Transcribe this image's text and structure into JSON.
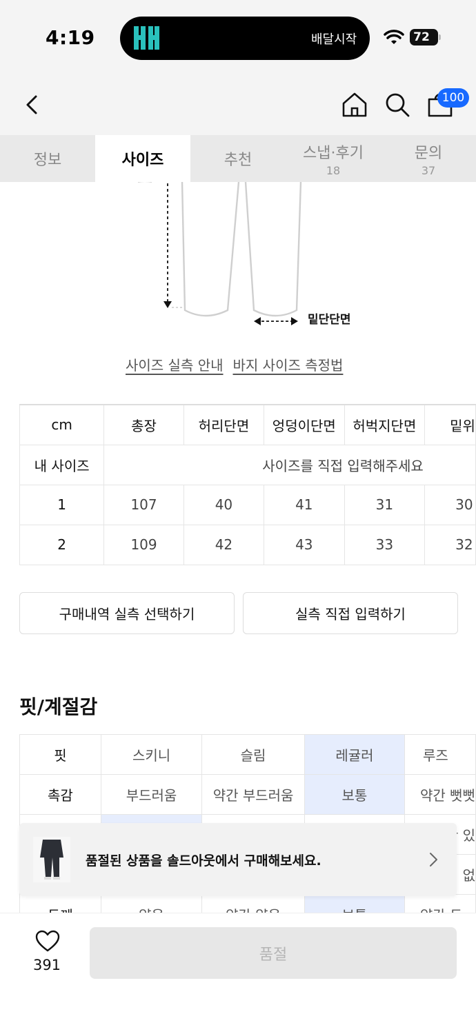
{
  "status": {
    "time": "4:19",
    "island_text": "배달시작",
    "battery": "72"
  },
  "header": {
    "cart_count": "100"
  },
  "tabs": [
    {
      "label": "정보",
      "count": ""
    },
    {
      "label": "사이즈",
      "count": ""
    },
    {
      "label": "추천",
      "count": ""
    },
    {
      "label": "스냅·후기",
      "count": "18"
    },
    {
      "label": "문의",
      "count": "37"
    }
  ],
  "diagram": {
    "hem_label": "밑단단면"
  },
  "guide_links": [
    "사이즈 실측 안내",
    "바지 사이즈 측정법"
  ],
  "size_table": {
    "headers": [
      "cm",
      "총장",
      "허리단면",
      "엉덩이단면",
      "허벅지단면",
      "밑위"
    ],
    "my_size_label": "내 사이즈",
    "my_size_placeholder": "사이즈를 직접 입력해주세요",
    "rows": [
      {
        "size": "1",
        "values": [
          "107",
          "40",
          "41",
          "31",
          "30"
        ]
      },
      {
        "size": "2",
        "values": [
          "109",
          "42",
          "43",
          "33",
          "32"
        ]
      }
    ]
  },
  "buttons": {
    "purchase_history": "구매내역 실측 선택하기",
    "manual_input": "실측 직접 입력하기"
  },
  "fit_section": {
    "title": "핏/계절감",
    "rows": [
      {
        "label": "핏",
        "options": [
          "스키니",
          "슬림",
          "레귤러",
          "루즈"
        ],
        "selected": 2
      },
      {
        "label": "촉감",
        "options": [
          "부드러움",
          "약간 부드러움",
          "보통",
          "약간 뻣뻣"
        ],
        "selected": 2
      },
      {
        "label": "",
        "options": [
          "",
          "",
          "",
          "간 있"
        ],
        "selected": 0
      },
      {
        "label": "",
        "options": [
          "",
          "",
          "",
          "의 없"
        ],
        "selected": -1
      },
      {
        "label": "두께",
        "options": [
          "얇음",
          "약간 얇음",
          "보통",
          "약간 두"
        ],
        "selected": 2
      }
    ]
  },
  "banner": {
    "text": "품절된 상품을 솔드아웃에서 구매해보세요."
  },
  "bottom": {
    "like_count": "391",
    "soldout_label": "품절"
  },
  "colors": {
    "accent": "#1769ff",
    "selected_cell": "#e6edfd"
  }
}
